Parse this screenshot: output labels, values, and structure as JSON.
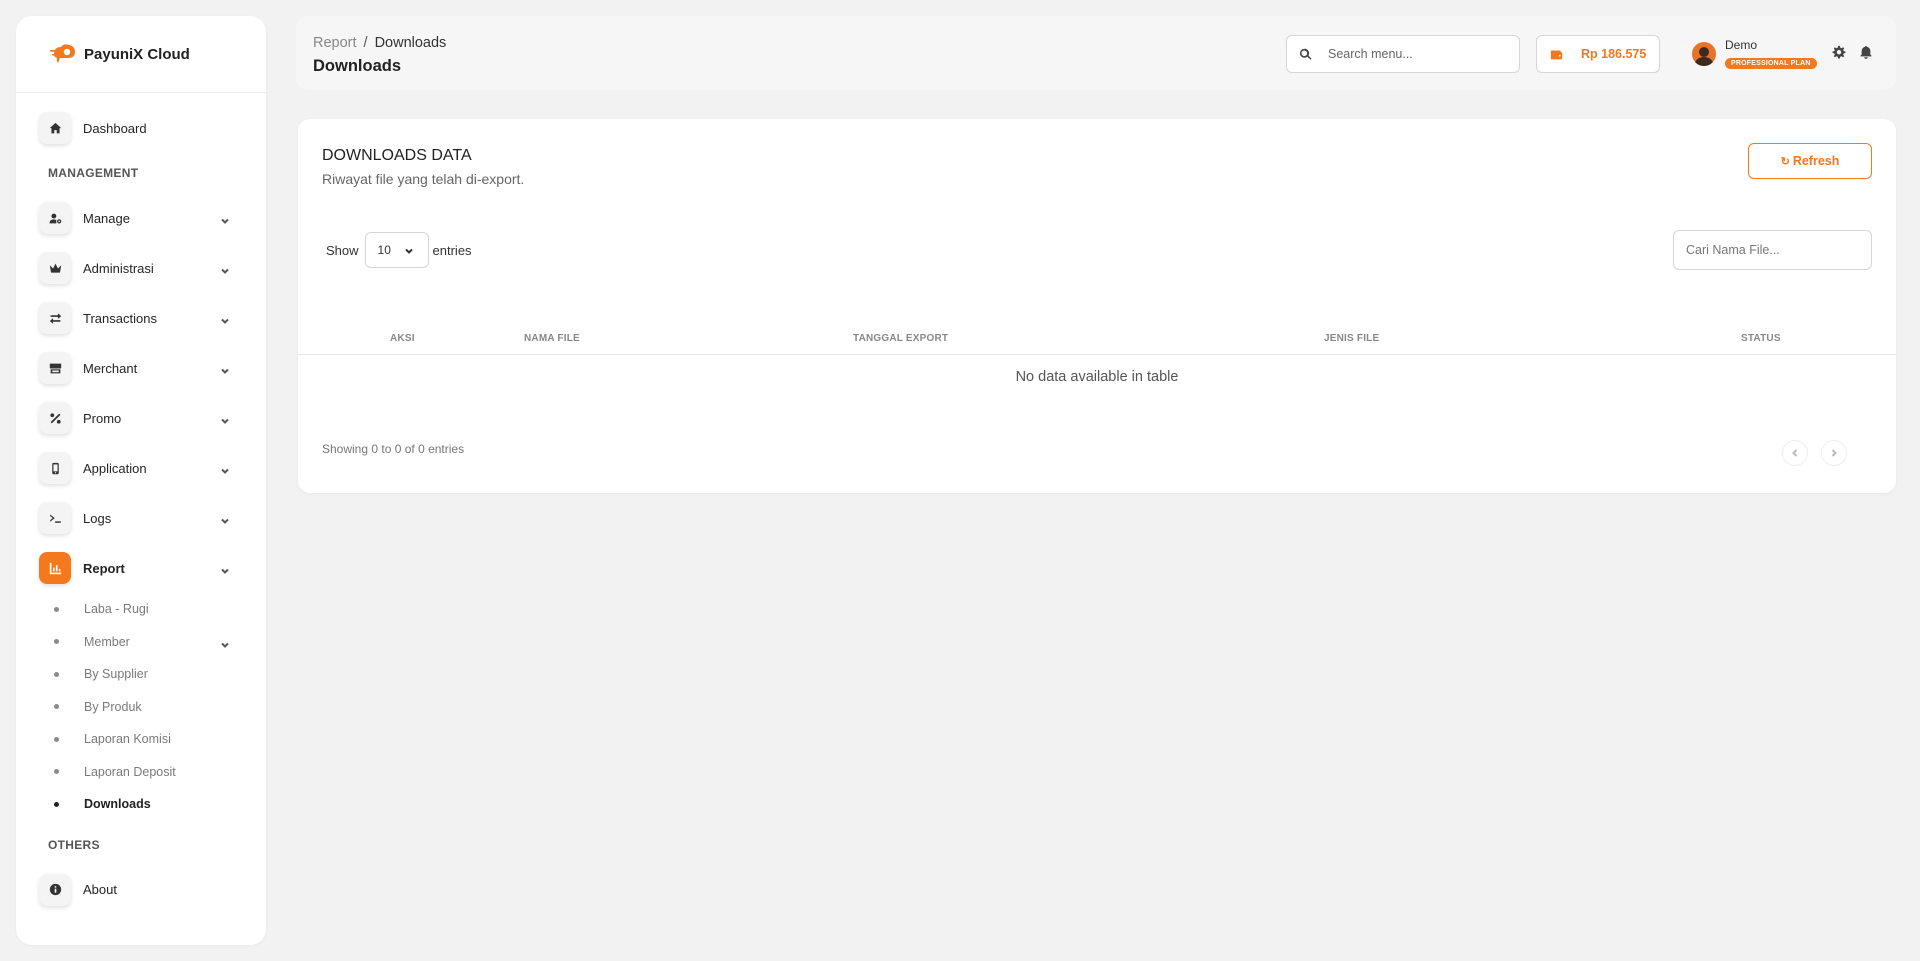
{
  "brand": {
    "name": "PayuniX Cloud"
  },
  "sidebar": {
    "dashboard": "Dashboard",
    "management_title": "MANAGEMENT",
    "items": [
      {
        "label": "Manage",
        "icon": "user-cog-icon"
      },
      {
        "label": "Administrasi",
        "icon": "crown-icon"
      },
      {
        "label": "Transactions",
        "icon": "arrows-swap-icon"
      },
      {
        "label": "Merchant",
        "icon": "store-icon"
      },
      {
        "label": "Promo",
        "icon": "percent-icon"
      },
      {
        "label": "Application",
        "icon": "mobile-icon"
      },
      {
        "label": "Logs",
        "icon": "terminal-icon"
      },
      {
        "label": "Report",
        "icon": "chart-icon"
      }
    ],
    "report_sub": [
      "Laba - Rugi",
      "Member",
      "By Supplier",
      "By Produk",
      "Laporan Komisi",
      "Laporan Deposit",
      "Downloads"
    ],
    "others_title": "OTHERS",
    "about": "About"
  },
  "header": {
    "breadcrumb_parent": "Report",
    "breadcrumb_sep": "/",
    "breadcrumb_current": "Downloads",
    "title": "Downloads",
    "search_placeholder": "Search menu...",
    "balance": "Rp 186.575",
    "user_name": "Demo",
    "plan": "PROFESSIONAL PLAN"
  },
  "card": {
    "title": "DOWNLOADS DATA",
    "subtitle": "Riwayat file yang telah di-export.",
    "refresh_label": "Refresh",
    "show_label": "Show",
    "page_length": "10",
    "entries_label": "entries",
    "filter_placeholder": "Cari Nama File...",
    "columns": [
      "AKSI",
      "NAMA FILE",
      "TANGGAL EXPORT",
      "JENIS FILE",
      "STATUS"
    ],
    "empty_text": "No data available in table",
    "info": "Showing 0 to 0 of 0 entries"
  },
  "colors": {
    "accent": "#f4781e",
    "background": "#f2f2f2"
  }
}
